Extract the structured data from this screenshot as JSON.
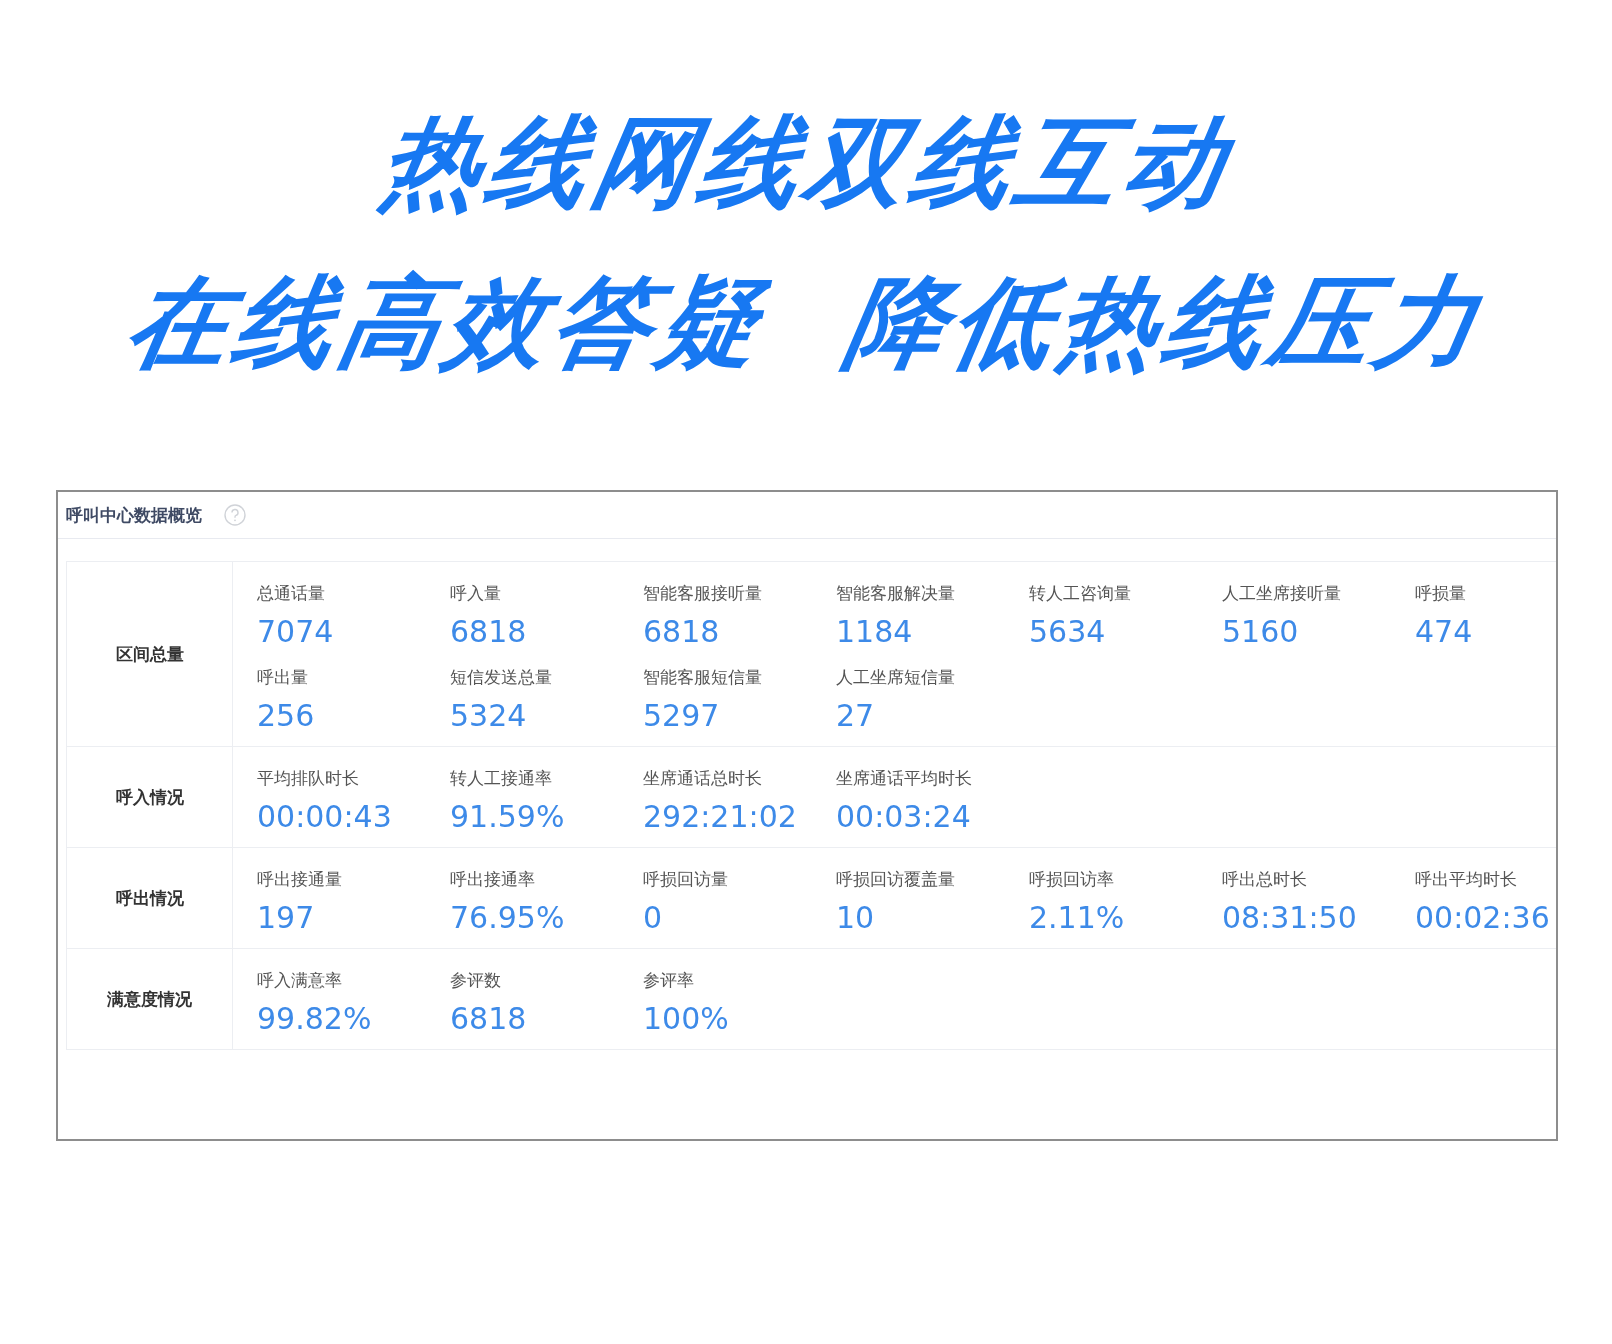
{
  "headline": [
    "热线网线双线互动",
    "在线高效答疑  降低热线压力"
  ],
  "panel": {
    "title": "呼叫中心数据概览",
    "sections": [
      {
        "label": "区间总量",
        "metrics": [
          {
            "label": "总通话量",
            "value": "7074"
          },
          {
            "label": "呼入量",
            "value": "6818"
          },
          {
            "label": "智能客服接听量",
            "value": "6818"
          },
          {
            "label": "智能客服解决量",
            "value": "1184"
          },
          {
            "label": "转人工咨询量",
            "value": "5634"
          },
          {
            "label": "人工坐席接听量",
            "value": "5160"
          },
          {
            "label": "呼损量",
            "value": "474"
          },
          {
            "label": "呼出量",
            "value": "256"
          },
          {
            "label": "短信发送总量",
            "value": "5324"
          },
          {
            "label": "智能客服短信量",
            "value": "5297"
          },
          {
            "label": "人工坐席短信量",
            "value": "27"
          }
        ]
      },
      {
        "label": "呼入情况",
        "metrics": [
          {
            "label": "平均排队时长",
            "value": "00:00:43"
          },
          {
            "label": "转人工接通率",
            "value": "91.59%"
          },
          {
            "label": "坐席通话总时长",
            "value": "292:21:02"
          },
          {
            "label": "坐席通话平均时长",
            "value": "00:03:24"
          }
        ]
      },
      {
        "label": "呼出情况",
        "metrics": [
          {
            "label": "呼出接通量",
            "value": "197"
          },
          {
            "label": "呼出接通率",
            "value": "76.95%"
          },
          {
            "label": "呼损回访量",
            "value": "0"
          },
          {
            "label": "呼损回访覆盖量",
            "value": "10"
          },
          {
            "label": "呼损回访率",
            "value": "2.11%"
          },
          {
            "label": "呼出总时长",
            "value": "08:31:50"
          },
          {
            "label": "呼出平均时长",
            "value": "00:02:36"
          }
        ]
      },
      {
        "label": "满意度情况",
        "metrics": [
          {
            "label": "呼入满意率",
            "value": "99.82%"
          },
          {
            "label": "参评数",
            "value": "6818"
          },
          {
            "label": "参评率",
            "value": "100%"
          }
        ]
      }
    ]
  }
}
